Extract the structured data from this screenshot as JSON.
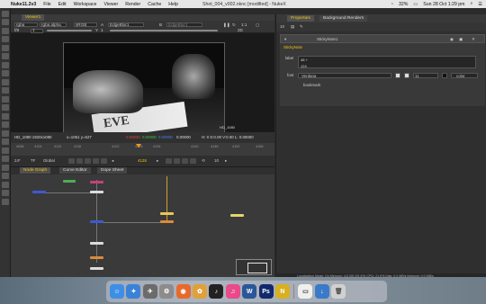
{
  "menubar": {
    "app": "Nuke11.2v3",
    "items": [
      "File",
      "Edit",
      "Workspace",
      "Viewer",
      "Render",
      "Cache",
      "Help"
    ],
    "title": "Shot_004_v002.nknc [modified] - NukeX",
    "battery": "32%",
    "clock": "Sun 28 Oct  1:29 pm"
  },
  "viewer": {
    "tab": "Viewer1",
    "channels": "rgba",
    "alpha": "rgba.alpha",
    "colorspace": "sRGB",
    "node_a": "A",
    "node_a_name": "EdgeBlur1",
    "node_b": "B",
    "node_b_name": "EdgeBlur1",
    "frame_range": "f/8",
    "gain": "1",
    "y_label": "Y",
    "gamma": "1",
    "zoom": "1:1",
    "proxy": "2D",
    "frame_label": "HD_1080",
    "info_format": "HD_1080 1920x1080",
    "info_xy": "x=1061 y=527",
    "info_rgb": [
      "0.00000",
      "0.00000",
      "0.00000",
      "0.00000"
    ],
    "info_hsv": "H: 0 S:0.00 V:0.00  L: 0.00000"
  },
  "timeline": {
    "ticks": [
      "4098",
      "4104",
      "4110",
      "4116",
      "4122",
      "4128",
      "4134",
      "4140",
      "4146",
      "4152",
      "4158"
    ],
    "fps": "24*",
    "tf": "TF",
    "global": "Global",
    "current_frame": "4128",
    "step": "10",
    "end": "4150"
  },
  "nodegraph": {
    "tabs": [
      "Node Graph",
      "Curve Editor",
      "Dope Sheet"
    ]
  },
  "properties": {
    "tabs": [
      "Properties",
      "Background Renders"
    ],
    "count": "10",
    "node_name": "StickyNote1",
    "node_tab": "StickyNote",
    "label_field": "label",
    "label_value_line1": "48 +",
    "label_value_line2": "124",
    "font_field": "font",
    "font_value": "Verdana",
    "font_size": "11",
    "color_label": "color",
    "bookmark": "bookmark"
  },
  "status": "Localization Mode: On  Memory: 4.6 GB (29.4%)  CPU: 21.0%  Disk: 0.0 MB/s  Network: 0.0 MB/s",
  "dock": {
    "icons": [
      "Finder",
      "Safari",
      "Launchpad",
      "System Preferences",
      "Firefox",
      "Photos",
      "Logic Pro",
      "iTunes",
      "Word",
      "Photoshop",
      "Nuke",
      "Preview",
      "Downloads",
      "Trash"
    ],
    "colors": [
      "#3d8ee6",
      "#3a82d8",
      "#6b6b6b",
      "#8c8c8c",
      "#e8692a",
      "#e0a03a",
      "#222222",
      "#e84a8a",
      "#2b579a",
      "#11296b",
      "#d8b020",
      "#efefef",
      "#3b79c9",
      "#d0d0d0"
    ]
  }
}
